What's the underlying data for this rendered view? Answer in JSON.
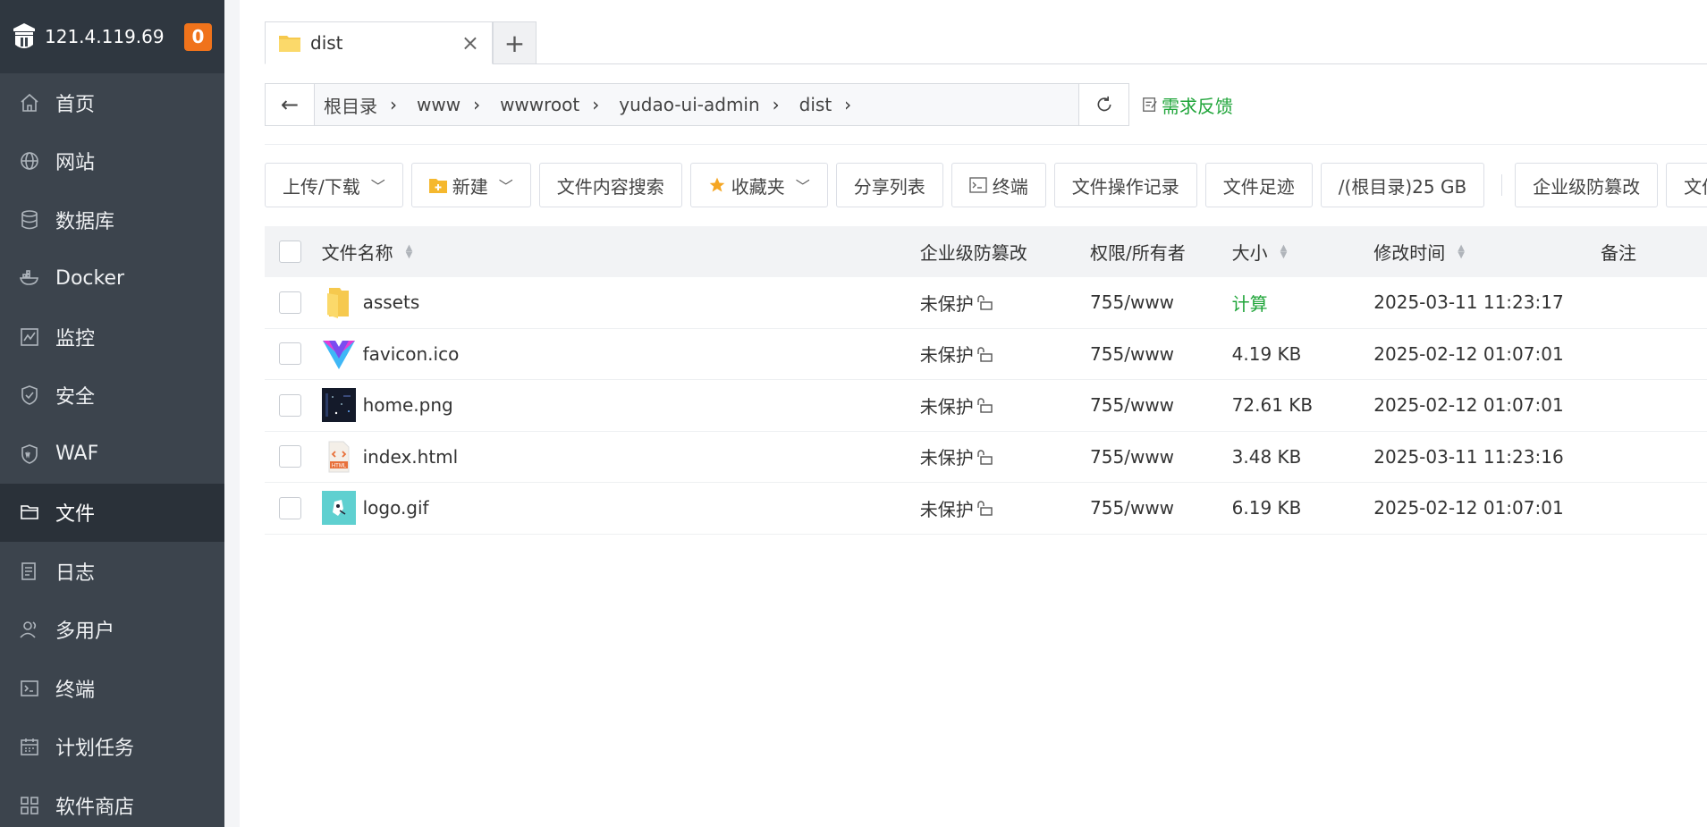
{
  "sidebar": {
    "server_ip": "121.4.119.69",
    "alert_count": "0",
    "items": [
      {
        "label": "首页",
        "icon": "home-icon",
        "active": false
      },
      {
        "label": "网站",
        "icon": "globe-icon",
        "active": false
      },
      {
        "label": "数据库",
        "icon": "database-icon",
        "active": false
      },
      {
        "label": "Docker",
        "icon": "docker-icon",
        "active": false
      },
      {
        "label": "监控",
        "icon": "monitor-chart-icon",
        "active": false
      },
      {
        "label": "安全",
        "icon": "shield-icon",
        "active": false
      },
      {
        "label": "WAF",
        "icon": "waf-shield-icon",
        "active": false
      },
      {
        "label": "文件",
        "icon": "folder-icon",
        "active": true
      },
      {
        "label": "日志",
        "icon": "log-icon",
        "active": false
      },
      {
        "label": "多用户",
        "icon": "users-icon",
        "active": false
      },
      {
        "label": "终端",
        "icon": "terminal-icon",
        "active": false
      },
      {
        "label": "计划任务",
        "icon": "calendar-icon",
        "active": false
      },
      {
        "label": "软件商店",
        "icon": "apps-grid-icon",
        "active": false
      }
    ]
  },
  "tabs": {
    "active_label": "dist",
    "add_label": "+",
    "close_label": "×"
  },
  "path": {
    "back_label": "←",
    "crumbs": [
      "根目录",
      "www",
      "wwwroot",
      "yudao-ui-admin",
      "dist"
    ],
    "separator": "›",
    "feedback_label": "需求反馈"
  },
  "toolbar": {
    "upload": "上传/下载",
    "new": "新建",
    "content_search": "文件内容搜索",
    "favorites": "收藏夹",
    "share_list": "分享列表",
    "terminal": "终端",
    "op_log": "文件操作记录",
    "footprint": "文件足迹",
    "disk": "/(根目录)25 GB",
    "tamper": "企业级防篡改",
    "sync": "文件同"
  },
  "table": {
    "headers": {
      "name": "文件名称",
      "protect": "企业级防篡改",
      "perm": "权限/所有者",
      "size": "大小",
      "mtime": "修改时间",
      "note": "备注"
    },
    "rows": [
      {
        "name": "assets",
        "icon": "folder-icon",
        "protect": "未保护",
        "perm": "755/www",
        "size": "计算",
        "mtime": "2025-03-11 11:23:17"
      },
      {
        "name": "favicon.ico",
        "icon": "vue-logo-icon",
        "protect": "未保护",
        "perm": "755/www",
        "size": "4.19 KB",
        "mtime": "2025-02-12 01:07:01"
      },
      {
        "name": "home.png",
        "icon": "image-thumbnail-icon",
        "protect": "未保护",
        "perm": "755/www",
        "size": "72.61 KB",
        "mtime": "2025-02-12 01:07:01"
      },
      {
        "name": "index.html",
        "icon": "html-file-icon",
        "protect": "未保护",
        "perm": "755/www",
        "size": "3.48 KB",
        "mtime": "2025-03-11 11:23:16"
      },
      {
        "name": "logo.gif",
        "icon": "gif-thumbnail-icon",
        "protect": "未保护",
        "perm": "755/www",
        "size": "6.19 KB",
        "mtime": "2025-02-12 01:07:01"
      }
    ]
  },
  "colors": {
    "sidebar_bg": "#3c444d",
    "sidebar_active": "#2a3139",
    "badge": "#f0731b",
    "accent_green": "#20a53a"
  }
}
